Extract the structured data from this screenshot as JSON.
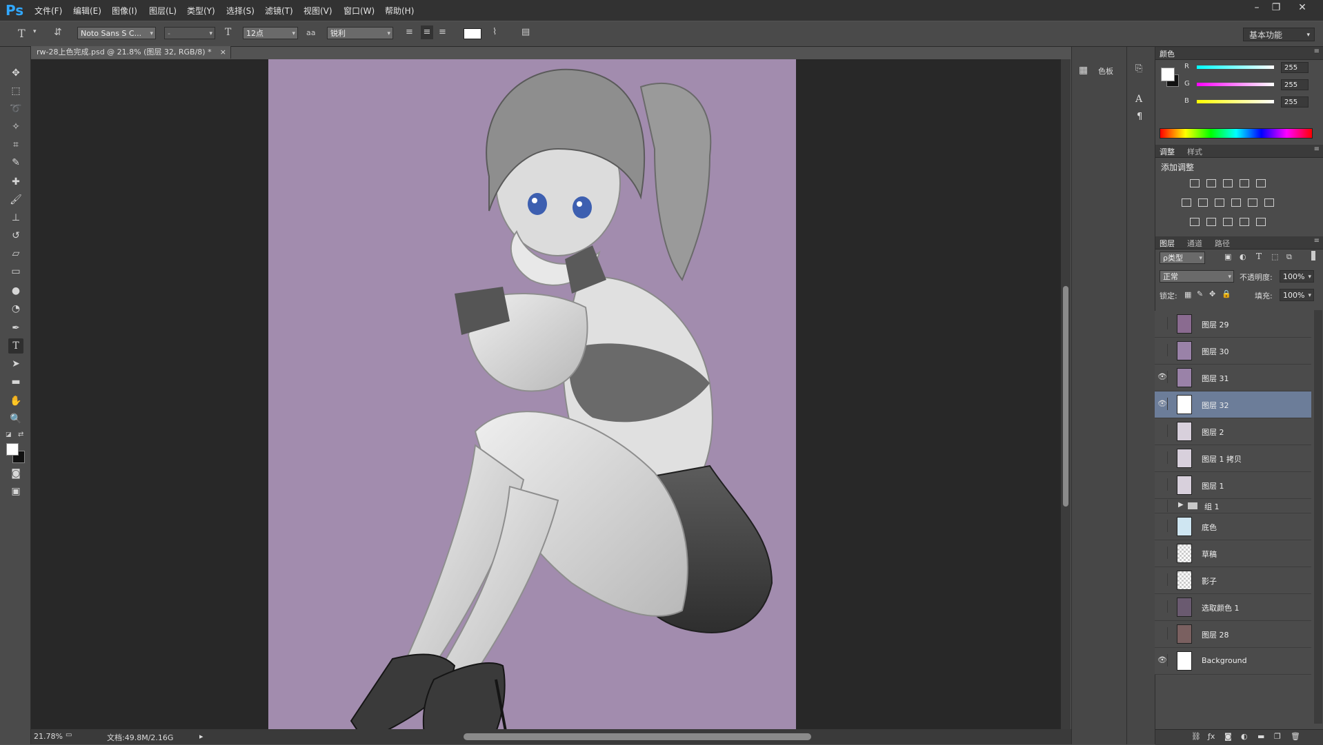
{
  "app": {
    "logo": "Ps"
  },
  "menu": [
    "文件(F)",
    "编辑(E)",
    "图像(I)",
    "图层(L)",
    "类型(Y)",
    "选择(S)",
    "滤镜(T)",
    "视图(V)",
    "窗口(W)",
    "帮助(H)"
  ],
  "window_controls": [
    "–",
    "❐",
    "✕"
  ],
  "options": {
    "font_family": "Noto Sans S C...",
    "font_style": "-",
    "font_size": "12点",
    "aa_icon": "aa",
    "antialias": "锐利",
    "workspace": "基本功能"
  },
  "document": {
    "tab_title": "rw-28上色完成.psd @ 21.8% (图层 32, RGB/8) *",
    "zoom": "21.78%",
    "doc_size": "文档:49.8M/2.16G"
  },
  "strip_panel": {
    "swatches_label": "色板"
  },
  "color_panel": {
    "tab": "颜色",
    "channels": [
      {
        "name": "R",
        "value": "255",
        "color": "#3fd6d6"
      },
      {
        "name": "G",
        "value": "255",
        "color": "#e040c8"
      },
      {
        "name": "B",
        "value": "255",
        "color": "#e8e03a"
      }
    ]
  },
  "adjustments_panel": {
    "tabs": [
      "调整",
      "样式"
    ],
    "heading": "添加调整"
  },
  "layers_panel": {
    "tabs": [
      "图层",
      "通道",
      "路径"
    ],
    "filter_kind": "ρ类型",
    "blend_mode": "正常",
    "opacity_label": "不透明度:",
    "opacity": "100%",
    "lock_label": "锁定:",
    "fill_label": "填充:",
    "fill": "100%",
    "layers": [
      {
        "name": "图层 29",
        "visible": false,
        "selected": false,
        "thumb": "#8a6b90"
      },
      {
        "name": "图层 30",
        "visible": false,
        "selected": false,
        "thumb": "#9a82a8"
      },
      {
        "name": "图层 31",
        "visible": true,
        "selected": false,
        "thumb": "#9a82a8"
      },
      {
        "name": "图层 32",
        "visible": true,
        "selected": true,
        "thumb": "#ffffff"
      },
      {
        "name": "图层 2",
        "visible": false,
        "selected": false,
        "thumb": "#d8d0dc"
      },
      {
        "name": "图层 1 拷贝",
        "visible": false,
        "selected": false,
        "thumb": "#d8d0dc"
      },
      {
        "name": "图层 1",
        "visible": false,
        "selected": false,
        "thumb": "#d8d0dc"
      },
      {
        "name": "组 1",
        "visible": false,
        "selected": false,
        "group": true
      },
      {
        "name": "底色",
        "visible": false,
        "selected": false,
        "thumb": "#cfe6f2"
      },
      {
        "name": "草稿",
        "visible": false,
        "selected": false,
        "thumb": "checker"
      },
      {
        "name": "影子",
        "visible": false,
        "selected": false,
        "thumb": "checker"
      },
      {
        "name": "选取颜色 1",
        "visible": false,
        "selected": false,
        "thumb": "#6a5a70"
      },
      {
        "name": "图层 28",
        "visible": false,
        "selected": false,
        "thumb": "#7a6060"
      },
      {
        "name": "Background",
        "visible": true,
        "selected": false,
        "thumb": "#ffffff"
      }
    ]
  }
}
